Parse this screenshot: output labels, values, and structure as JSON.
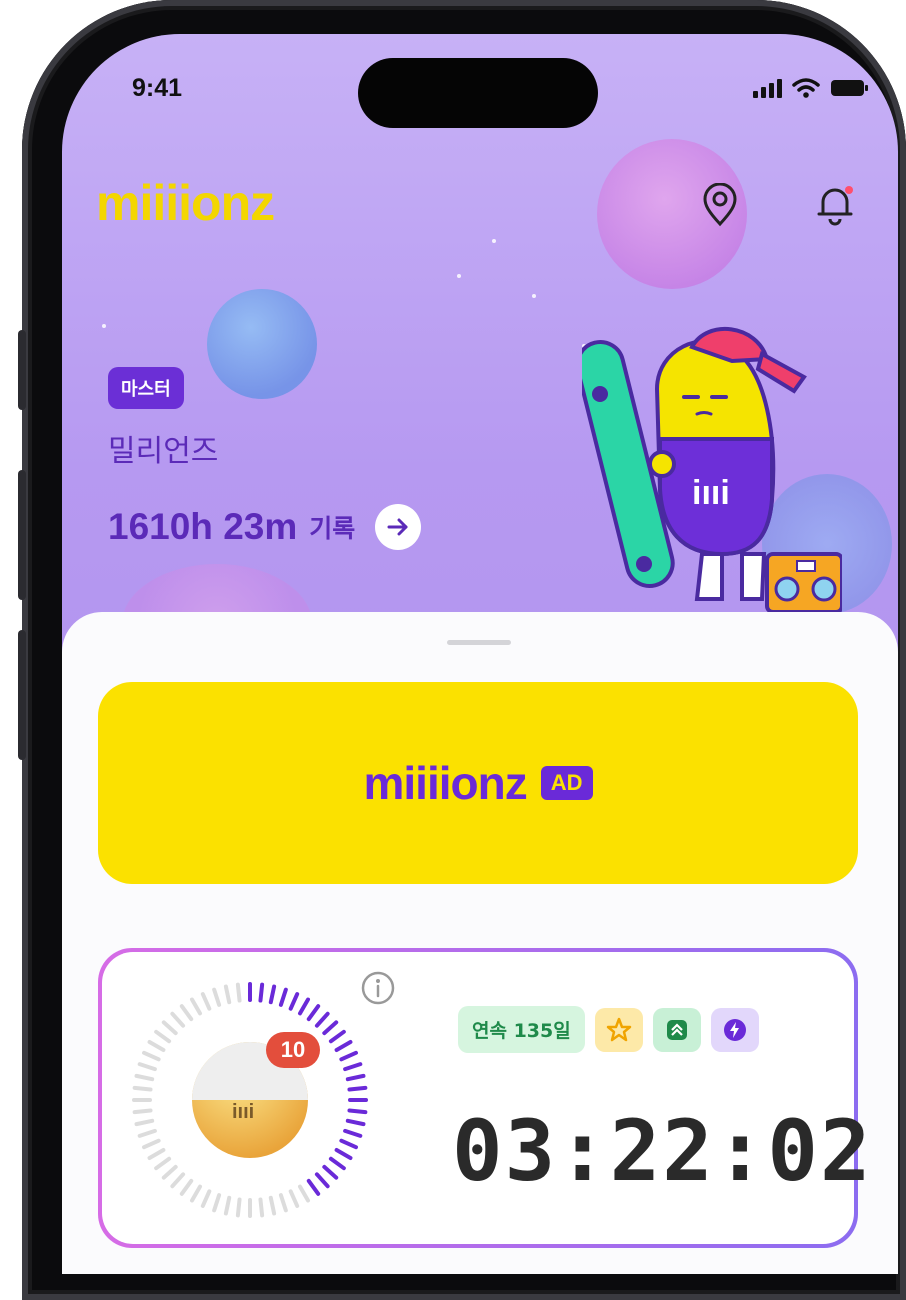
{
  "status_bar": {
    "time": "9:41",
    "signal_icon": "signal-icon",
    "wifi_icon": "wifi-icon",
    "battery_icon": "battery-icon"
  },
  "header": {
    "logo": "miiiionz",
    "location_icon": "location-pin-icon",
    "bell_icon": "bell-icon"
  },
  "profile": {
    "level_badge": "마스터",
    "name": "밀리언즈",
    "record_value": "1610h 23m",
    "record_label": "기록"
  },
  "ad": {
    "logo": "miiiionz",
    "tag": "AD"
  },
  "timer": {
    "streak": "연속 135일",
    "time": "03:22:02",
    "medal_count": "10"
  },
  "colors": {
    "accent": "#6b2fd6",
    "brand_yellow": "#fbe100",
    "background": "#b699f1"
  }
}
